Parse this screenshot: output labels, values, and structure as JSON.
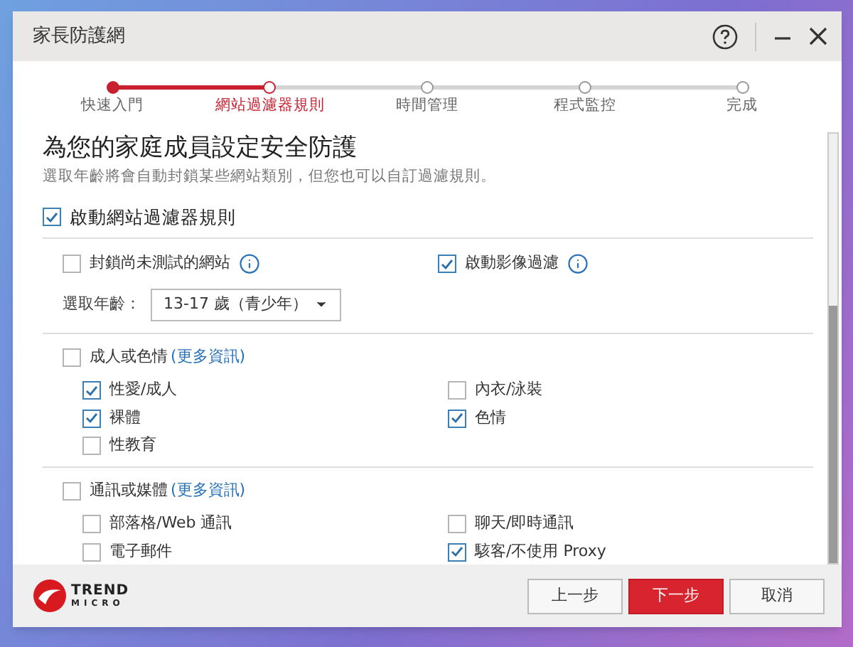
{
  "window": {
    "title": "家長防護網"
  },
  "steps": [
    {
      "label": "快速入門",
      "completed": true,
      "selected": false
    },
    {
      "label": "網站過濾器規則",
      "completed": false,
      "selected": true
    },
    {
      "label": "時間管理",
      "completed": false,
      "selected": false
    },
    {
      "label": "程式監控",
      "completed": false,
      "selected": false
    },
    {
      "label": "完成",
      "completed": false,
      "selected": false
    }
  ],
  "heading": "為您的家庭成員設定安全防護",
  "subtitle": "選取年齡將會自動封鎖某些網站類別，但您也可以自訂過濾規則。",
  "master": {
    "label": "啟動網站過濾器規則",
    "checked": true
  },
  "options": [
    {
      "label": "封鎖尚未測試的網站",
      "checked": false
    },
    {
      "label": "啟動影像過濾",
      "checked": true
    }
  ],
  "age": {
    "label": "選取年齡：",
    "value": "13-17 歲（青少年）"
  },
  "categories": [
    {
      "label": "成人或色情",
      "link": "(更多資訊)",
      "checked": false,
      "items": [
        {
          "label": "性愛/成人",
          "checked": true
        },
        {
          "label": "內衣/泳裝",
          "checked": false
        },
        {
          "label": "裸體",
          "checked": true
        },
        {
          "label": "色情",
          "checked": true
        },
        {
          "label": "性教育",
          "checked": false
        }
      ]
    },
    {
      "label": "通訊或媒體",
      "link": "(更多資訊)",
      "checked": false,
      "items": [
        {
          "label": "部落格/Web 通訊",
          "checked": false
        },
        {
          "label": "聊天/即時通訊",
          "checked": false
        },
        {
          "label": "電子郵件",
          "checked": false
        },
        {
          "label": "駭客/不使用 Proxy",
          "checked": true
        }
      ]
    }
  ],
  "logo": {
    "line_1": "TREND",
    "line_2": "MICRO"
  },
  "buttons": [
    {
      "label": "上一步",
      "kind": "secondary"
    },
    {
      "label": "下一步",
      "kind": "primary"
    },
    {
      "label": "取消",
      "kind": "secondary"
    }
  ]
}
